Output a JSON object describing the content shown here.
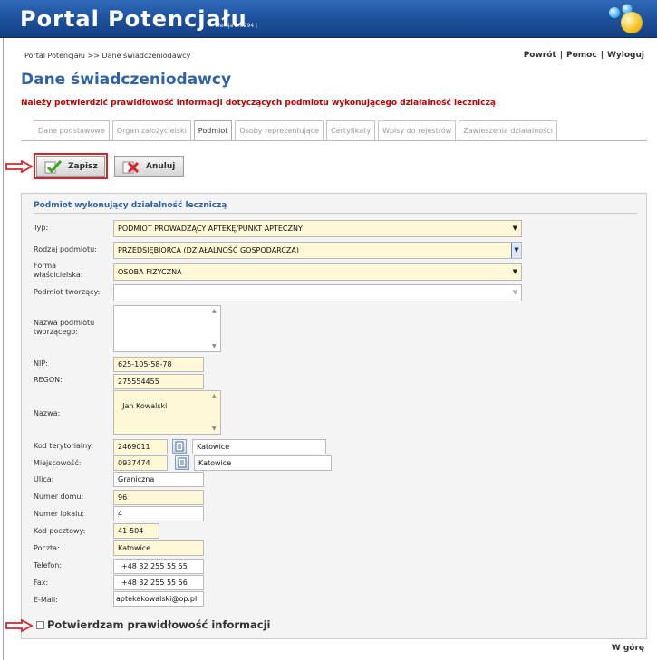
{
  "header": {
    "title": "Portal Potencjału",
    "version": "Wersja 2.0294 |"
  },
  "breadcrumb": "Portal Potencjału >> Dane świadczeniodawcy",
  "top_links": {
    "back": "Powrót",
    "help": "Pomoc",
    "logout": "Wyloguj",
    "separator": "|"
  },
  "page_title": "Dane świadczeniodawcy",
  "warning": "Należy potwierdzić prawidłowość informacji dotyczących podmiotu wykonującego działalność leczniczą",
  "tabs": [
    {
      "label": "Dane podstawowe"
    },
    {
      "label": "Organ założycielski"
    },
    {
      "label": "Podmiot"
    },
    {
      "label": "Osoby reprezentujące"
    },
    {
      "label": "Certyfikaty"
    },
    {
      "label": "Wpisy do rejestrów"
    },
    {
      "label": "Zawieszenia działalności"
    }
  ],
  "active_tab": "Podmiot",
  "toolbar": {
    "save_label": "Zapisz",
    "cancel_label": "Anuluj"
  },
  "section_title": "Podmiot wykonujący działalność leczniczą",
  "form": {
    "typ": {
      "label": "Typ:",
      "value": "PODMIOT PROWADZĄCY APTEKĘ/PUNKT APTECZNY"
    },
    "rodzaj": {
      "label": "Rodzaj podmiotu:",
      "value": "PRZEDSIĘBIORCA (DZIAŁALNOŚĆ GOSPODARCZA)"
    },
    "forma": {
      "label": "Forma właścicielska:",
      "value": "OSOBA FIZYCZNA"
    },
    "tworzacy": {
      "label": "Podmiot tworzący:",
      "value": ""
    },
    "nazwa_tworzacego": {
      "label": "Nazwa podmiotu tworzącego:",
      "value": ""
    },
    "nip": {
      "label": "NIP:",
      "value": "625-105-58-78"
    },
    "regon": {
      "label": "REGON:",
      "value": "275554455"
    },
    "nazwa": {
      "label": "Nazwa:",
      "value": "Jan Kowalski"
    },
    "kod_terytorialny": {
      "label": "Kod terytorialny:",
      "value": "2469011",
      "name": "Katowice"
    },
    "miejscowosc": {
      "label": "Miejscowość:",
      "value": "0937474",
      "name": "Katowice"
    },
    "ulica": {
      "label": "Ulica:",
      "value": "Graniczna"
    },
    "numer_domu": {
      "label": "Numer domu:",
      "value": "96"
    },
    "numer_lokalu": {
      "label": "Numer lokalu:",
      "value": "4"
    },
    "kod_pocztowy": {
      "label": "Kod pocztowy:",
      "value": "41-504"
    },
    "poczta": {
      "label": "Poczta:",
      "value": "Katowice"
    },
    "telefon": {
      "label": "Telefon:",
      "value": "+48 32 255 55 55"
    },
    "fax": {
      "label": "Fax:",
      "value": "+48 32 255 55 56"
    },
    "email": {
      "label": "E-Mail:",
      "value": "aptekakowalski@op.pl"
    }
  },
  "confirm_label": "Potwierdzam prawidłowość informacji",
  "back_to_top": "W górę",
  "colors": {
    "header_blue": "#1d4f9a",
    "title_blue": "#2e63a8",
    "warning_red": "#c00000",
    "highlight_red": "#d9232a",
    "required_field": "#fff8d6"
  },
  "icons": [
    "logo-dots-icon",
    "save-check-icon",
    "cancel-x-icon",
    "arrow-right-icon",
    "picker-list-icon"
  ]
}
